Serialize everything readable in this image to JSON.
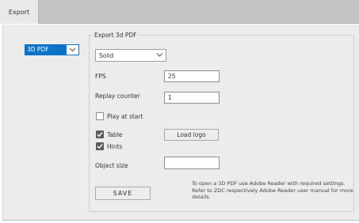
{
  "tabs": [
    {
      "label": "Export"
    }
  ],
  "format_select": {
    "value": "3D PDF"
  },
  "group": {
    "legend": "Export 3d PDF",
    "mode_select": {
      "value": "Solid"
    },
    "fps": {
      "label": "FPS",
      "value": "25"
    },
    "replay": {
      "label": "Replay counter",
      "value": "1"
    },
    "play_at_start": {
      "label": "Play at start",
      "checked": false
    },
    "table": {
      "label": "Table",
      "checked": true
    },
    "hints": {
      "label": "Hints",
      "checked": true
    },
    "load_logo_label": "Load logo",
    "object_size": {
      "label": "Object size",
      "value": ""
    },
    "save_label": "SAVE",
    "info_text": "To open a 3D PDF use Adobe Reader with required settings. Refer to ZDC respectively Adobe Reader user manual for more details."
  },
  "colors": {
    "accent": "#0a72c7",
    "tab_bar": "#c4c4c4",
    "panel": "#ececec"
  },
  "icons": {
    "dropdown": "chevron-down-icon",
    "check": "checkmark-icon"
  }
}
